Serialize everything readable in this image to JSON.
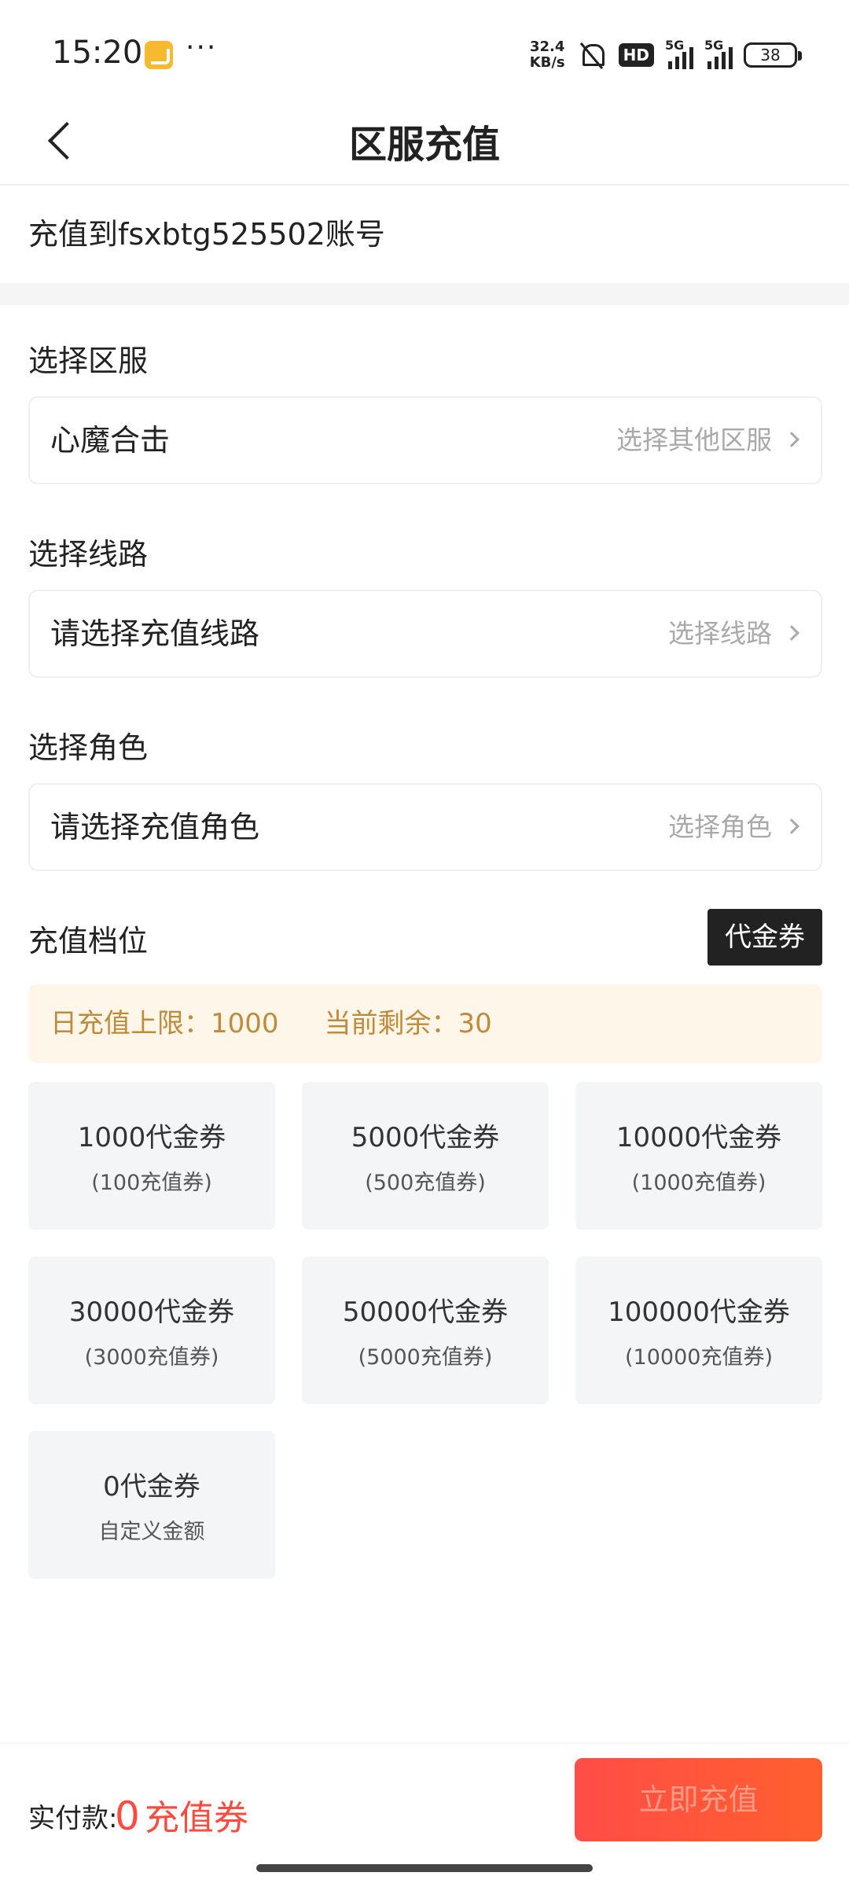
{
  "status_bar": {
    "time": "15:20",
    "more": "···",
    "net_speed_value": "32.4",
    "net_speed_unit": "KB/s",
    "hd_label": "HD",
    "network_1": "5G",
    "network_2": "5G",
    "battery": "38"
  },
  "header": {
    "title": "区服充值"
  },
  "account": {
    "text": "充值到fsxbtg525502账号"
  },
  "server": {
    "label": "选择区服",
    "value": "心魔合击",
    "action": "选择其他区服"
  },
  "route": {
    "label": "选择线路",
    "placeholder": "请选择充值线路",
    "action": "选择线路"
  },
  "role": {
    "label": "选择角色",
    "placeholder": "请选择充值角色",
    "action": "选择角色"
  },
  "tiers": {
    "label": "充值档位",
    "voucher_button": "代金券",
    "limit_text": "日充值上限：1000",
    "remaining_text": "当前剩余：30",
    "items": [
      {
        "main": "1000代金券",
        "sub": "(100充值券)"
      },
      {
        "main": "5000代金券",
        "sub": "(500充值券)"
      },
      {
        "main": "10000代金券",
        "sub": "(1000充值券)"
      },
      {
        "main": "30000代金券",
        "sub": "(3000充值券)"
      },
      {
        "main": "50000代金券",
        "sub": "(5000充值券)"
      },
      {
        "main": "100000代金券",
        "sub": "(10000充值券)"
      },
      {
        "main": "0代金券",
        "sub": "自定义金额"
      }
    ]
  },
  "footer": {
    "pay_label": "实付款:",
    "pay_amount": "0",
    "pay_unit": "充值券",
    "charge_button": "立即充值"
  },
  "colors": {
    "accent_red": "#ff4a3d",
    "banner_bg": "#fff6ea",
    "banner_text": "#c08a3a",
    "card_bg": "#f4f5f7"
  }
}
